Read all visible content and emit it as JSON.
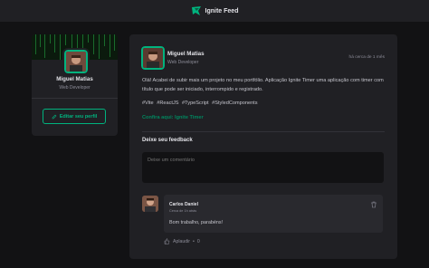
{
  "header": {
    "title": "Ignite Feed"
  },
  "sidebar": {
    "name": "Miguel Matias",
    "role": "Web Developer",
    "edit_label": "Editar seu perfil"
  },
  "post": {
    "author": {
      "name": "Miguel Matias",
      "role": "Web Developer"
    },
    "time": "há cerca de 1 mês",
    "paragraph": "Olá! Acabei de subir mais um projeto no meu portfólio. Aplicação Ignite Timer uma aplicação com timer com título que pode ser iniciado, interrompido e registrado.",
    "tags": [
      "#Vite",
      "#ReactJS",
      "#TypeScript",
      "#StyledComponents"
    ],
    "link": "Confira aqui: Ignite Timer"
  },
  "feedback": {
    "title": "Deixe seu feedback",
    "placeholder": "Deixe um comentário"
  },
  "comment": {
    "author": "Carlos Daniel",
    "time": "Cerca de 1h atrás",
    "text": "Bom trabalho, parabéns!",
    "applaud_label": "Aplaudir",
    "applaud_count": "0"
  },
  "colors": {
    "accent": "#00b37e",
    "link": "#00875f",
    "background": "#121214",
    "card": "#202024"
  }
}
